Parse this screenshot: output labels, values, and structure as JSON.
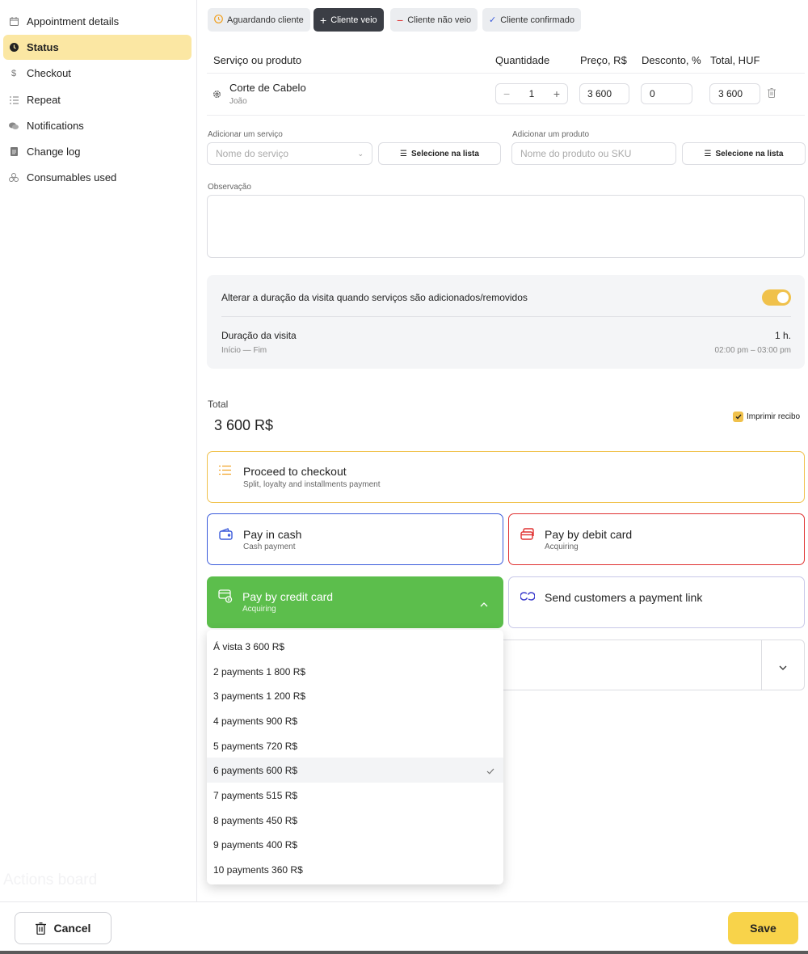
{
  "sidebar": {
    "items": [
      {
        "label": "Appointment details",
        "icon": "calendar-icon"
      },
      {
        "label": "Status",
        "icon": "clock-icon",
        "active": true
      },
      {
        "label": "Checkout",
        "icon": "dollar-icon"
      },
      {
        "label": "Repeat",
        "icon": "list-icon"
      },
      {
        "label": "Notifications",
        "icon": "chat-icon"
      },
      {
        "label": "Change log",
        "icon": "document-icon"
      },
      {
        "label": "Consumables used",
        "icon": "consumables-icon"
      }
    ],
    "faint_text": "Actions board"
  },
  "status_chips": [
    {
      "label": "Aguardando cliente",
      "icon": "clock-icon"
    },
    {
      "label": "Cliente veio",
      "icon": "plus-icon",
      "active": true
    },
    {
      "label": "Cliente não veio",
      "icon": "minus-icon"
    },
    {
      "label": "Cliente confirmado",
      "icon": "check-icon"
    }
  ],
  "table": {
    "headers": {
      "service": "Serviço ou produto",
      "quantity": "Quantidade",
      "price": "Preço, R$",
      "discount": "Desconto, %",
      "total": "Total, HUF"
    },
    "rows": [
      {
        "name": "Corte de Cabelo",
        "employee": "João",
        "quantity": "1",
        "price": "3 600",
        "discount": "0",
        "total": "3 600"
      }
    ]
  },
  "add_service": {
    "label": "Adicionar um serviço",
    "placeholder": "Nome do serviço",
    "select_button": "Selecione na lista"
  },
  "add_product": {
    "label": "Adicionar um produto",
    "placeholder": "Nome do produto ou SKU",
    "select_button": "Selecione na lista"
  },
  "note": {
    "label": "Observação",
    "value": ""
  },
  "duration": {
    "toggle_label": "Alterar a duração da visita quando serviços são adicionados/removidos",
    "toggle_on": true,
    "title": "Duração da visita",
    "value": "1 h.",
    "range_label": "Início — Fim",
    "range_value": "02:00 pm – 03:00 pm"
  },
  "total": {
    "label": "Total",
    "value": "3 600 R$",
    "print_receipt": "Imprimir recibo",
    "print_checked": true
  },
  "pay_options": {
    "checkout": {
      "title": "Proceed to checkout",
      "sub": "Split, loyalty and installments payment"
    },
    "cash": {
      "title": "Pay in cash",
      "sub": "Cash payment"
    },
    "debit": {
      "title": "Pay by debit card",
      "sub": "Acquiring"
    },
    "credit": {
      "title": "Pay by credit card",
      "sub": "Acquiring"
    },
    "link": {
      "title": "Send customers a payment link"
    }
  },
  "installments": {
    "options": [
      "Á vista 3 600 R$",
      "2 payments 1 800 R$",
      "3 payments 1 200 R$",
      "4 payments 900 R$",
      "5 payments 720 R$",
      "6 payments 600 R$",
      "7 payments 515 R$",
      "8 payments 450 R$",
      "9 payments 400 R$",
      "10 payments 360 R$"
    ],
    "selected_index": 5
  },
  "footer": {
    "cancel_label": "Cancel",
    "save_label": "Save"
  },
  "colors": {
    "accent_yellow": "#f8d34a",
    "active_nav": "#fbe7a3",
    "checkout_border": "#f0c14b",
    "cash_border": "#3b5bdb",
    "debit_border": "#e03131",
    "credit_green": "#5cbe4c",
    "link_border": "#c8c8e8"
  }
}
